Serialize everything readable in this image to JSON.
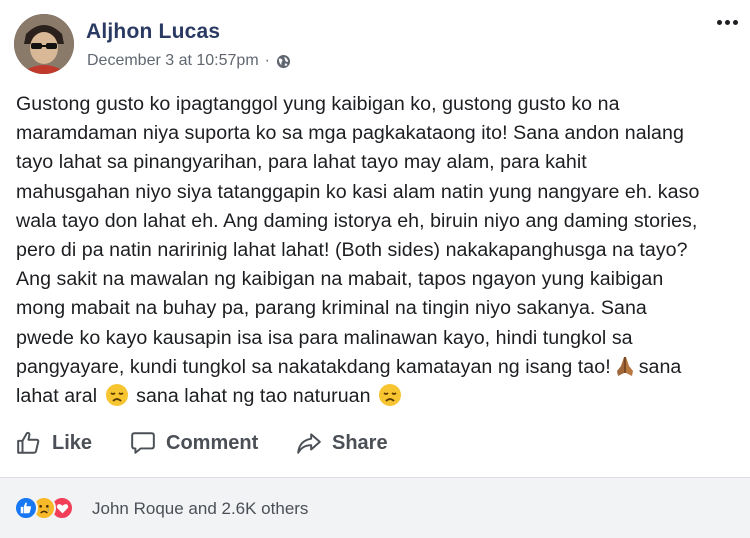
{
  "post": {
    "author": "Aljhon Lucas",
    "timestamp": "December 3 at 10:57pm",
    "separator": "·",
    "privacy_icon": "globe-icon",
    "text_lines": [
      "Gustong gusto ko ipagtanggol yung kaibigan ko, gustong gusto ko na",
      "maramdaman niya suporta ko sa mga pagkakataong ito! Sana andon nalang",
      "tayo lahat sa pinangyarihan, para lahat tayo may alam, para kahit",
      "mahusgahan niyo siya tatanggapin ko kasi alam natin yung nangyare eh. kaso",
      "wala tayo don lahat eh. Ang daming istorya eh, biruin niyo ang daming stories,",
      "pero di pa natin naririnig lahat lahat! (Both sides) nakakapanghusga na tayo?",
      "Ang sakit na mawalan ng kaibigan na mabait, tapos ngayon yung kaibigan",
      "mong mabait na buhay pa, parang kriminal na tingin niyo sakanya. Sana",
      "pwede ko kayo kausapin isa isa para malinawan kayo, hindi tungkol sa",
      "pangyayare, kundi tungkol sa nakatakdang kamatayan ng isang tao!"
    ],
    "line10_after_emoji": "sana",
    "line11_part1": "lahat aral",
    "line11_part2": "sana lahat ng tao naturuan",
    "emojis": [
      "folded-hands-emoji",
      "disappointed-face-emoji",
      "disappointed-face-emoji"
    ]
  },
  "actions": {
    "like_label": "Like",
    "comment_label": "Comment",
    "share_label": "Share"
  },
  "reactions": {
    "icons": [
      "like-reaction-icon",
      "sad-reaction-icon",
      "love-reaction-icon"
    ],
    "summary": "John Roque and 2.6K others"
  },
  "colors": {
    "author": "#2b3a63",
    "meta": "#606770",
    "action": "#4b4f56",
    "like_blue": "#1877f2",
    "love_red": "#f33e58",
    "sad_yellow": "#f7b928",
    "footer_bg": "#f2f3f5"
  }
}
